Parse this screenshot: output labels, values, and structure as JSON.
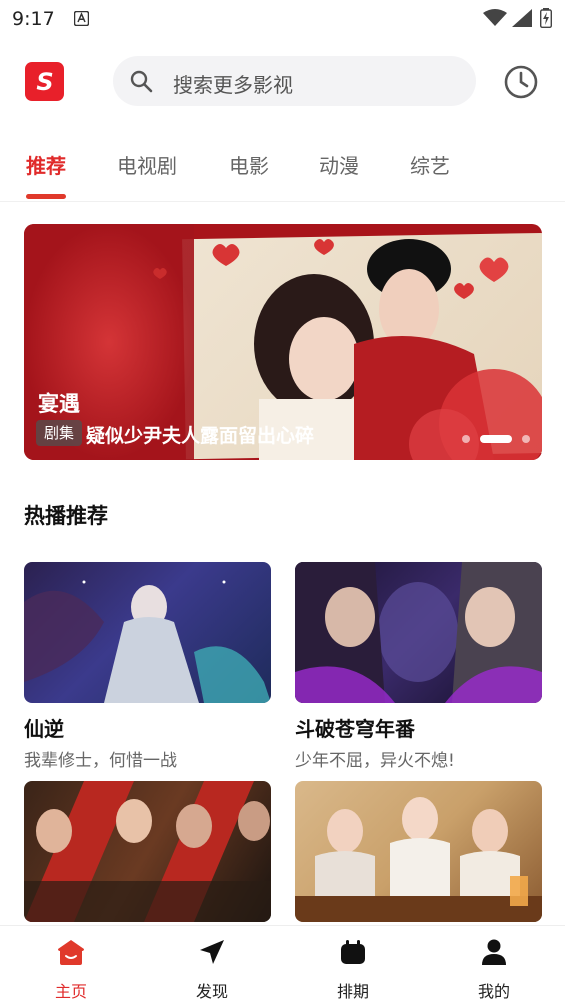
{
  "status_bar": {
    "time": "9:17"
  },
  "search": {
    "placeholder": "搜索更多影视"
  },
  "tabs": [
    {
      "label": "推荐",
      "active": true
    },
    {
      "label": "电视剧",
      "active": false
    },
    {
      "label": "电影",
      "active": false
    },
    {
      "label": "动漫",
      "active": false
    },
    {
      "label": "综艺",
      "active": false
    }
  ],
  "banner": {
    "title": "宴遇",
    "tag": "剧集",
    "description": "疑似少尹夫人露面留出心碎"
  },
  "section": {
    "title": "热播推荐"
  },
  "cards": [
    {
      "name": "仙逆",
      "subtitle": "我辈修士，何惜一战"
    },
    {
      "name": "斗破苍穹年番",
      "subtitle": "少年不屈，异火不熄!"
    },
    {
      "name": "",
      "subtitle": ""
    },
    {
      "name": "",
      "subtitle": ""
    }
  ],
  "bottom_nav": [
    {
      "label": "主页",
      "icon": "home-icon",
      "active": true
    },
    {
      "label": "发现",
      "icon": "discover-icon",
      "active": false
    },
    {
      "label": "排期",
      "icon": "schedule-icon",
      "active": false
    },
    {
      "label": "我的",
      "icon": "profile-icon",
      "active": false
    }
  ],
  "colors": {
    "accent": "#e02b2b",
    "logo": "#e8202a"
  }
}
